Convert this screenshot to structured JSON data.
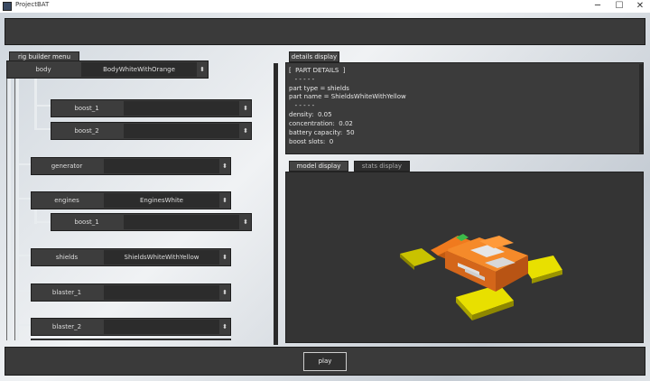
{
  "window": {
    "title": "ProjectBAT",
    "minimize_glyph": "─",
    "maximize_glyph": "☐",
    "close_glyph": "✕"
  },
  "left_panel": {
    "tab_label": "rig builder menu",
    "rows": [
      {
        "label": "body",
        "value": "BodyWhiteWithOrange",
        "arrow": "⬍"
      },
      {
        "label": "boost_1",
        "value": "",
        "arrow": "⬍"
      },
      {
        "label": "boost_2",
        "value": "",
        "arrow": "⬍"
      },
      {
        "label": "generator",
        "value": "",
        "arrow": "⬍"
      },
      {
        "label": "engines",
        "value": "EnginesWhite",
        "arrow": "⬍"
      },
      {
        "label": "boost_1",
        "value": "",
        "arrow": "⬍"
      },
      {
        "label": "shields",
        "value": "ShieldsWhiteWithYellow",
        "arrow": "⬍"
      },
      {
        "label": "blaster_1",
        "value": "",
        "arrow": "⬍"
      },
      {
        "label": "blaster_2",
        "value": "",
        "arrow": "⬍"
      }
    ]
  },
  "details_panel": {
    "tab_label": "details display",
    "lines": [
      "[  PART DETAILS  ]",
      "   - - - - -",
      "part type = shields",
      "part name = ShieldsWhiteWithYellow",
      "   - - - - -",
      "density:  0.05",
      "concentration:  0.02",
      "battery capacity:  50",
      "boost slots:  0"
    ]
  },
  "viewport": {
    "tabs": [
      {
        "label": "model display",
        "active": true
      },
      {
        "label": "stats display",
        "active": false
      }
    ],
    "model_colors": {
      "body": "#f07a1e",
      "shields": "#e8e000",
      "light": "#3dbb4a"
    }
  },
  "footer": {
    "play_label": "play"
  }
}
